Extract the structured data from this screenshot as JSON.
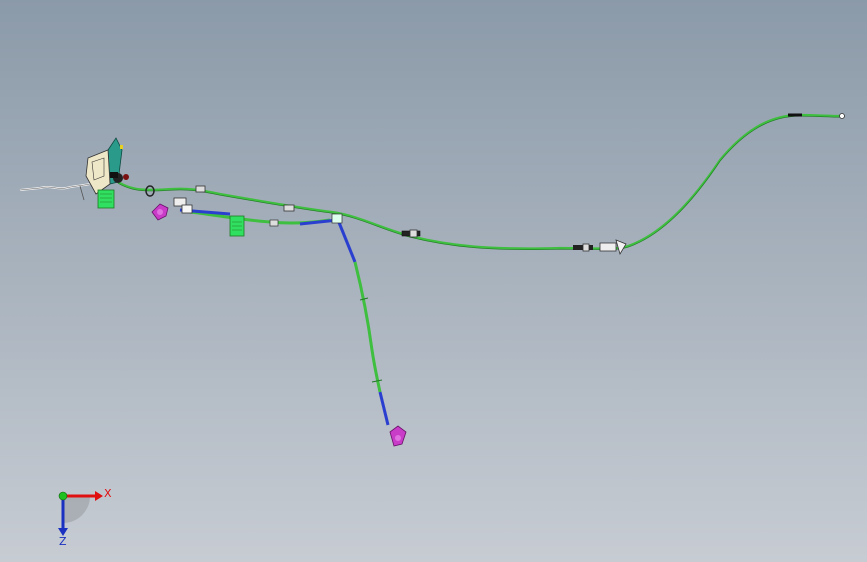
{
  "viewport": {
    "background_top": "#8b9aa9",
    "background_bottom": "#c7ccd3"
  },
  "model": {
    "harness_color": "#3fbf3f",
    "harness_dark": "#1e7a22",
    "branch_color": "#2a3fcf",
    "connector_magenta": "#c83cc8",
    "connector_green": "#30e060",
    "bracket_teal": "#2a9a8a",
    "bracket_cream": "#efe8c8"
  },
  "triad": {
    "x_label": "X",
    "z_label": "Z",
    "x_color": "#e01010",
    "y_color": "#20c020",
    "z_color": "#1a30c0"
  }
}
